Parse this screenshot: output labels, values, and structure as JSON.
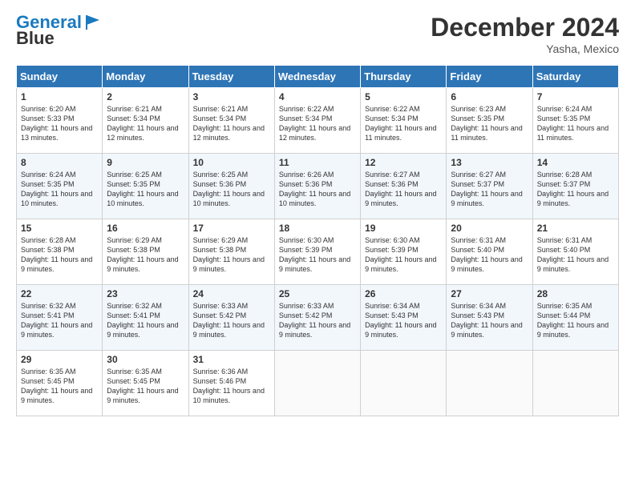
{
  "logo": {
    "line1": "General",
    "line2": "Blue"
  },
  "title": "December 2024",
  "location": "Yasha, Mexico",
  "days_of_week": [
    "Sunday",
    "Monday",
    "Tuesday",
    "Wednesday",
    "Thursday",
    "Friday",
    "Saturday"
  ],
  "weeks": [
    [
      {
        "day": "1",
        "sunrise": "6:20 AM",
        "sunset": "5:33 PM",
        "daylight": "11 hours and 13 minutes."
      },
      {
        "day": "2",
        "sunrise": "6:21 AM",
        "sunset": "5:34 PM",
        "daylight": "11 hours and 12 minutes."
      },
      {
        "day": "3",
        "sunrise": "6:21 AM",
        "sunset": "5:34 PM",
        "daylight": "11 hours and 12 minutes."
      },
      {
        "day": "4",
        "sunrise": "6:22 AM",
        "sunset": "5:34 PM",
        "daylight": "11 hours and 12 minutes."
      },
      {
        "day": "5",
        "sunrise": "6:22 AM",
        "sunset": "5:34 PM",
        "daylight": "11 hours and 11 minutes."
      },
      {
        "day": "6",
        "sunrise": "6:23 AM",
        "sunset": "5:35 PM",
        "daylight": "11 hours and 11 minutes."
      },
      {
        "day": "7",
        "sunrise": "6:24 AM",
        "sunset": "5:35 PM",
        "daylight": "11 hours and 11 minutes."
      }
    ],
    [
      {
        "day": "8",
        "sunrise": "6:24 AM",
        "sunset": "5:35 PM",
        "daylight": "11 hours and 10 minutes."
      },
      {
        "day": "9",
        "sunrise": "6:25 AM",
        "sunset": "5:35 PM",
        "daylight": "11 hours and 10 minutes."
      },
      {
        "day": "10",
        "sunrise": "6:25 AM",
        "sunset": "5:36 PM",
        "daylight": "11 hours and 10 minutes."
      },
      {
        "day": "11",
        "sunrise": "6:26 AM",
        "sunset": "5:36 PM",
        "daylight": "11 hours and 10 minutes."
      },
      {
        "day": "12",
        "sunrise": "6:27 AM",
        "sunset": "5:36 PM",
        "daylight": "11 hours and 9 minutes."
      },
      {
        "day": "13",
        "sunrise": "6:27 AM",
        "sunset": "5:37 PM",
        "daylight": "11 hours and 9 minutes."
      },
      {
        "day": "14",
        "sunrise": "6:28 AM",
        "sunset": "5:37 PM",
        "daylight": "11 hours and 9 minutes."
      }
    ],
    [
      {
        "day": "15",
        "sunrise": "6:28 AM",
        "sunset": "5:38 PM",
        "daylight": "11 hours and 9 minutes."
      },
      {
        "day": "16",
        "sunrise": "6:29 AM",
        "sunset": "5:38 PM",
        "daylight": "11 hours and 9 minutes."
      },
      {
        "day": "17",
        "sunrise": "6:29 AM",
        "sunset": "5:38 PM",
        "daylight": "11 hours and 9 minutes."
      },
      {
        "day": "18",
        "sunrise": "6:30 AM",
        "sunset": "5:39 PM",
        "daylight": "11 hours and 9 minutes."
      },
      {
        "day": "19",
        "sunrise": "6:30 AM",
        "sunset": "5:39 PM",
        "daylight": "11 hours and 9 minutes."
      },
      {
        "day": "20",
        "sunrise": "6:31 AM",
        "sunset": "5:40 PM",
        "daylight": "11 hours and 9 minutes."
      },
      {
        "day": "21",
        "sunrise": "6:31 AM",
        "sunset": "5:40 PM",
        "daylight": "11 hours and 9 minutes."
      }
    ],
    [
      {
        "day": "22",
        "sunrise": "6:32 AM",
        "sunset": "5:41 PM",
        "daylight": "11 hours and 9 minutes."
      },
      {
        "day": "23",
        "sunrise": "6:32 AM",
        "sunset": "5:41 PM",
        "daylight": "11 hours and 9 minutes."
      },
      {
        "day": "24",
        "sunrise": "6:33 AM",
        "sunset": "5:42 PM",
        "daylight": "11 hours and 9 minutes."
      },
      {
        "day": "25",
        "sunrise": "6:33 AM",
        "sunset": "5:42 PM",
        "daylight": "11 hours and 9 minutes."
      },
      {
        "day": "26",
        "sunrise": "6:34 AM",
        "sunset": "5:43 PM",
        "daylight": "11 hours and 9 minutes."
      },
      {
        "day": "27",
        "sunrise": "6:34 AM",
        "sunset": "5:43 PM",
        "daylight": "11 hours and 9 minutes."
      },
      {
        "day": "28",
        "sunrise": "6:35 AM",
        "sunset": "5:44 PM",
        "daylight": "11 hours and 9 minutes."
      }
    ],
    [
      {
        "day": "29",
        "sunrise": "6:35 AM",
        "sunset": "5:45 PM",
        "daylight": "11 hours and 9 minutes."
      },
      {
        "day": "30",
        "sunrise": "6:35 AM",
        "sunset": "5:45 PM",
        "daylight": "11 hours and 9 minutes."
      },
      {
        "day": "31",
        "sunrise": "6:36 AM",
        "sunset": "5:46 PM",
        "daylight": "11 hours and 10 minutes."
      },
      null,
      null,
      null,
      null
    ]
  ]
}
